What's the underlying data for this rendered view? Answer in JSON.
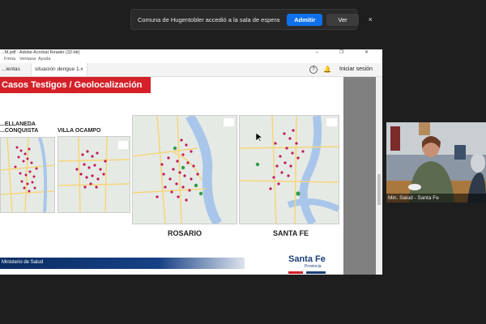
{
  "notification": {
    "message": "Comuna de Hugentobler accedió a la sala de espera",
    "admit_label": "Admitir",
    "view_label": "Ver",
    "close_icon": "×"
  },
  "app": {
    "window_title": "...M.pdf - Adobe Acrobat Reader (32-bit)",
    "window_buttons": "–  ❐  ✕",
    "menu": [
      "Firma",
      "Ventana",
      "Ayuda"
    ],
    "tabs": [
      "...ientas",
      "situación dengue 1..."
    ],
    "help_icon": "?",
    "login_label": "Iniciar sesión"
  },
  "slide": {
    "title": "Casos Testigos / Geolocalización",
    "labels": [
      "...ELLANEDA",
      "...CONQUISTA",
      "VILLA OCAMPO"
    ],
    "cities": [
      "ROSARIO",
      "SANTA FE"
    ],
    "footer": "Ministerio de Salud",
    "logo": "Santa Fe",
    "logo_sub": "Provincia"
  },
  "participant": {
    "name": "Min. Salud - Santa Fe"
  },
  "colors": {
    "accent": "#d32029",
    "navy": "#0a2e63",
    "zoom_blue": "#0e71eb",
    "map_land": "#e6eae5",
    "map_water": "#a9c6ea",
    "pin": "#c2185b"
  }
}
